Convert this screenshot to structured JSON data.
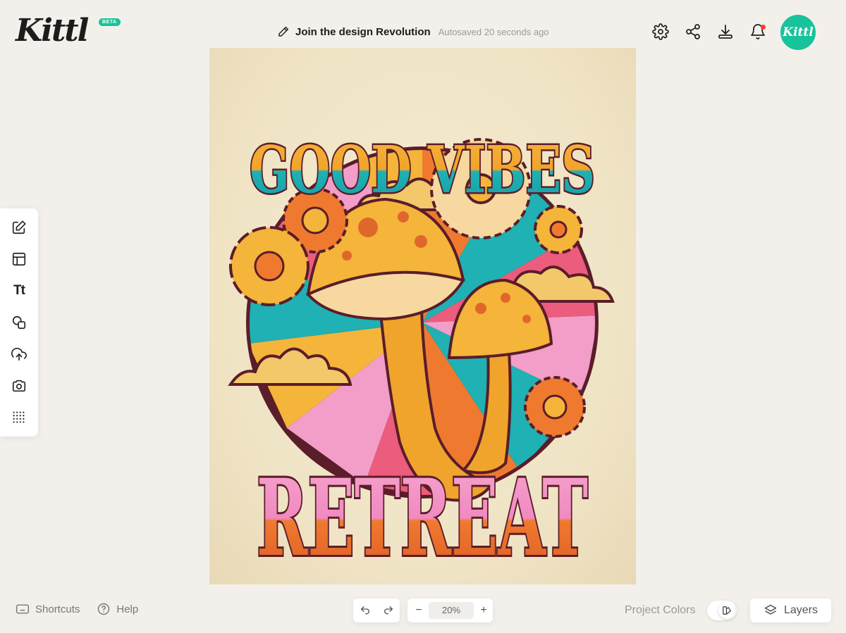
{
  "app": {
    "logo": "Kittl",
    "badge": "BETA"
  },
  "header": {
    "doc_title": "Join the design Revolution",
    "autosave": "Autosaved 20 seconds ago",
    "avatar_text": "Kittl",
    "icons": [
      "gear-icon",
      "share-icon",
      "download-icon",
      "bell-icon"
    ]
  },
  "left_tools": [
    "edit-icon",
    "templates-icon",
    "text-icon",
    "shapes-icon",
    "upload-icon",
    "camera-icon",
    "grid-icon"
  ],
  "left_tool_text": "Tt",
  "canvas": {
    "headline_top": "GOOD VIBES",
    "headline_bottom": "RETREAT"
  },
  "bottom": {
    "shortcuts": "Shortcuts",
    "help": "Help",
    "zoom": "20%",
    "zoom_minus": "−",
    "zoom_plus": "+",
    "project_colors": "Project Colors",
    "layers": "Layers"
  },
  "colors": {
    "accent": "#18c39b",
    "background": "#f3f0eb",
    "notification": "#ff3b30"
  }
}
